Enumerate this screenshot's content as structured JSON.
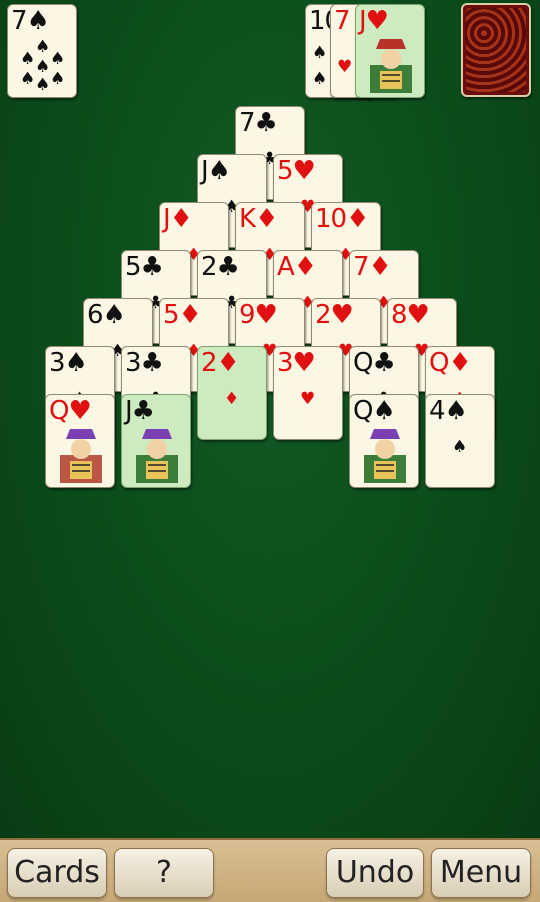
{
  "game": {
    "stock_top": {
      "rank": "7",
      "suit": "♠",
      "color": "black"
    },
    "waste": [
      {
        "rank": "10",
        "suit": "",
        "color": "black"
      },
      {
        "rank": "7",
        "suit": "",
        "color": "red"
      },
      {
        "rank": "J",
        "suit": "♥",
        "color": "red",
        "face": true,
        "highlight": true
      }
    ],
    "pyramid": [
      [
        {
          "rank": "7",
          "suit": "♣",
          "color": "black"
        }
      ],
      [
        {
          "rank": "J",
          "suit": "♠",
          "color": "black"
        },
        {
          "rank": "5",
          "suit": "♥",
          "color": "red"
        }
      ],
      [
        {
          "rank": "J",
          "suit": "♦",
          "color": "red"
        },
        {
          "rank": "K",
          "suit": "♦",
          "color": "red"
        },
        {
          "rank": "10",
          "suit": "♦",
          "color": "red"
        }
      ],
      [
        {
          "rank": "5",
          "suit": "♣",
          "color": "black"
        },
        {
          "rank": "2",
          "suit": "♣",
          "color": "black"
        },
        {
          "rank": "A",
          "suit": "♦",
          "color": "red"
        },
        {
          "rank": "7",
          "suit": "♦",
          "color": "red"
        }
      ],
      [
        {
          "rank": "6",
          "suit": "♠",
          "color": "black"
        },
        {
          "rank": "5",
          "suit": "♦",
          "color": "red"
        },
        {
          "rank": "9",
          "suit": "♥",
          "color": "red"
        },
        {
          "rank": "2",
          "suit": "♥",
          "color": "red"
        },
        {
          "rank": "8",
          "suit": "♥",
          "color": "red"
        }
      ],
      [
        {
          "rank": "3",
          "suit": "♠",
          "color": "black"
        },
        {
          "rank": "3",
          "suit": "♣",
          "color": "black"
        },
        {
          "rank": "2",
          "suit": "♦",
          "color": "red",
          "highlight": true
        },
        {
          "rank": "3",
          "suit": "♥",
          "color": "red"
        },
        {
          "rank": "Q",
          "suit": "♣",
          "color": "black"
        },
        {
          "rank": "Q",
          "suit": "♦",
          "color": "red"
        }
      ],
      [
        {
          "rank": "Q",
          "suit": "♥",
          "color": "red",
          "face": true
        },
        {
          "rank": "J",
          "suit": "♣",
          "color": "black",
          "face": true,
          "highlight": true
        },
        {
          "rank": "",
          "suit": "",
          "color": "black",
          "hidden": true
        },
        {
          "rank": "",
          "suit": "",
          "color": "black",
          "hidden": true
        },
        {
          "rank": "Q",
          "suit": "♠",
          "color": "black",
          "face": true
        },
        {
          "rank": "4",
          "suit": "♠",
          "color": "black"
        }
      ]
    ]
  },
  "toolbar": {
    "cards_label": "Cards",
    "help_label": "?",
    "undo_label": "Undo",
    "menu_label": "Menu"
  },
  "colors": {
    "felt": "#0d4b1c",
    "card_face": "#fbf7e4",
    "card_highlight": "#cdeac0",
    "red_suit": "#e01010",
    "card_back": "#6b0d0d"
  }
}
